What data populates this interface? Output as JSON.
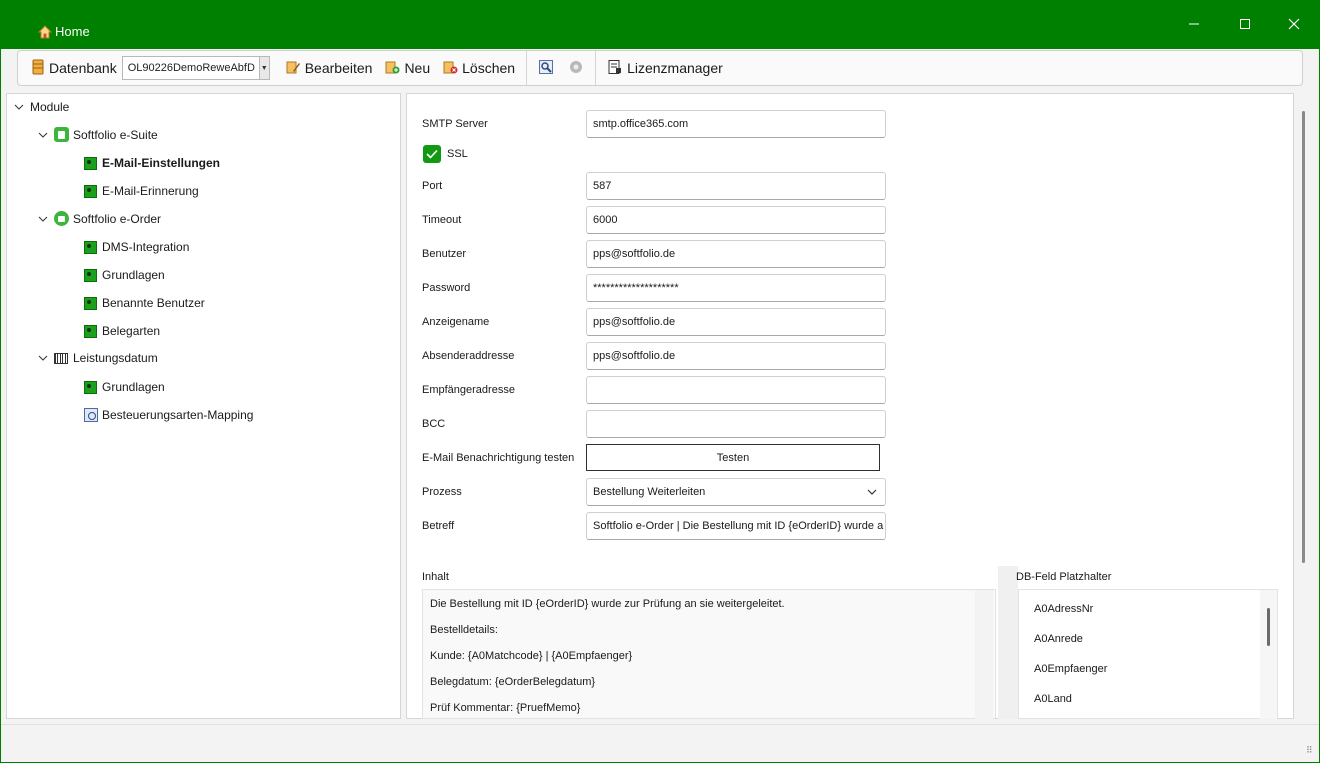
{
  "window": {
    "title": "Home",
    "minimize_icon": "minimize-icon",
    "maximize_icon": "maximize-icon",
    "close_icon": "close-icon"
  },
  "toolbar": {
    "datenbank_label": "Datenbank",
    "datenbank_value": "OL90226DemoReweAbfD",
    "bearbeiten_label": "Bearbeiten",
    "neu_label": "Neu",
    "loeschen_label": "Löschen",
    "lizenzmanager_label": "Lizenzmanager"
  },
  "tree": {
    "root": "Module",
    "groups": [
      {
        "label": "Softfolio e-Suite",
        "items": [
          "E-Mail-Einstellungen",
          "E-Mail-Erinnerung"
        ]
      },
      {
        "label": "Softfolio e-Order",
        "items": [
          "DMS-Integration",
          "Grundlagen",
          "Benannte Benutzer",
          "Belegarten"
        ]
      },
      {
        "label": "Leistungsdatum",
        "items": [
          "Grundlagen",
          "Besteuerungsarten-Mapping"
        ]
      }
    ],
    "selected": "E-Mail-Einstellungen"
  },
  "form": {
    "smtp_server": {
      "label": "SMTP Server",
      "value": "smtp.office365.com"
    },
    "ssl": {
      "label": "SSL",
      "checked": true
    },
    "port": {
      "label": "Port",
      "value": "587"
    },
    "timeout": {
      "label": "Timeout",
      "value": "6000"
    },
    "benutzer": {
      "label": "Benutzer",
      "value": "pps@softfolio.de"
    },
    "password": {
      "label": "Password",
      "value": "********************"
    },
    "anzeigename": {
      "label": "Anzeigename",
      "value": "pps@softfolio.de"
    },
    "absenderadresse": {
      "label": "Absenderaddresse",
      "value": "pps@softfolio.de"
    },
    "empfaengeradresse": {
      "label": "Empfängeradresse",
      "value": ""
    },
    "bcc": {
      "label": "BCC",
      "value": ""
    },
    "test": {
      "label": "E-Mail Benachrichtigung testen",
      "button": "Testen"
    },
    "prozess": {
      "label": "Prozess",
      "value": "Bestellung Weiterleiten"
    },
    "betreff": {
      "label": "Betreff",
      "value": "Softfolio e-Order | Die Bestellung mit ID {eOrderID} wurde a"
    }
  },
  "inhalt": {
    "label": "Inhalt",
    "lines": [
      "Die Bestellung mit ID {eOrderID} wurde zur Prüfung an sie weitergeleitet.",
      "Bestelldetails:",
      "Kunde: {A0Matchcode} | {A0Empfaenger}",
      "Belegdatum: {eOrderBelegdatum}",
      "Prüf Kommentar: {PruefMemo}"
    ]
  },
  "platzhalter": {
    "label": "DB-Feld Platzhalter",
    "items": [
      "A0AdressNr",
      "A0Anrede",
      "A0Empfaenger",
      "A0Land"
    ]
  },
  "colors": {
    "titlebar": "#008000",
    "accent_green": "#1aa01a"
  }
}
